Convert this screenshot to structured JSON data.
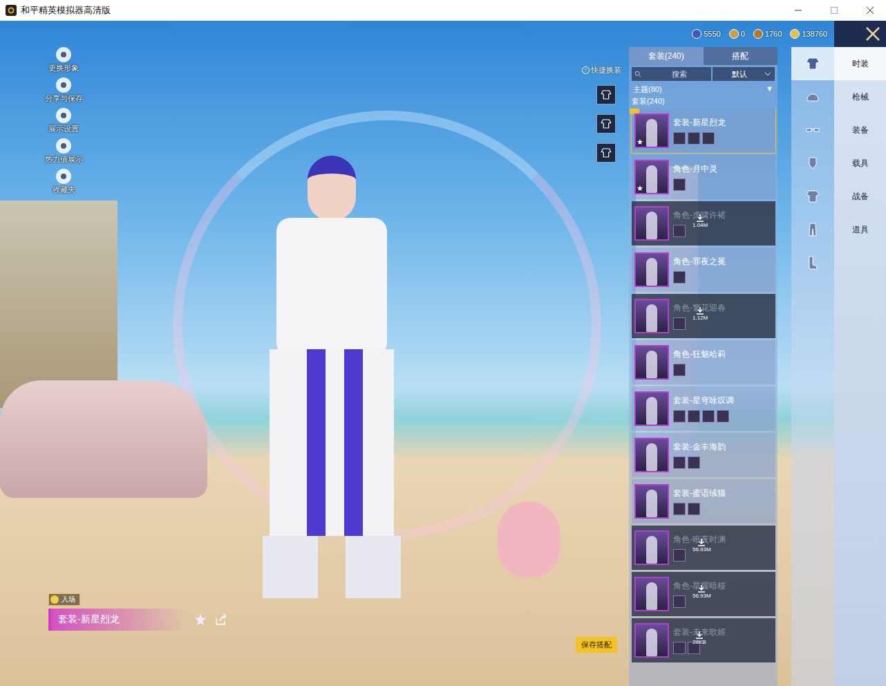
{
  "window": {
    "title": "和平精英模拟器高清版"
  },
  "currencies": [
    {
      "value": "5550",
      "color": "#3b5bb5"
    },
    {
      "value": "0",
      "color": "#c9a04a"
    },
    {
      "value": "1760",
      "color": "#b07a2a"
    },
    {
      "value": "138760",
      "color": "#e2c04a"
    }
  ],
  "leftMenu": [
    {
      "label": "更换形象"
    },
    {
      "label": "分享与保存"
    },
    {
      "label": "展示设置"
    },
    {
      "label": "热力值展示"
    },
    {
      "label": "收藏夹"
    }
  ],
  "quickChange": {
    "title": "快捷换装",
    "help": "?",
    "slots": [
      {
        "selected": false
      },
      {
        "selected": false
      },
      {
        "selected": false
      }
    ]
  },
  "tabs": [
    {
      "label": "套装(240)",
      "selected": true
    },
    {
      "label": "搭配",
      "selected": false
    }
  ],
  "search": {
    "placeholder": "搜索"
  },
  "sort": {
    "value": "默认"
  },
  "filter": {
    "label": "主题(80)",
    "arrow": "▼"
  },
  "section": "套装(240)",
  "items": [
    {
      "name": "套装-新星烈龙",
      "selected": true,
      "starred": true,
      "downloaded": true,
      "size": "",
      "parts": 3
    },
    {
      "name": "角色-月中灵",
      "selected": false,
      "starred": true,
      "downloaded": true,
      "size": "",
      "parts": 1
    },
    {
      "name": "角色-虎啸许褚",
      "selected": false,
      "starred": false,
      "downloaded": false,
      "size": "1.04M",
      "parts": 1
    },
    {
      "name": "角色-罪夜之冕",
      "selected": false,
      "starred": false,
      "downloaded": true,
      "size": "",
      "parts": 1
    },
    {
      "name": "角色-繁花迎春",
      "selected": false,
      "starred": false,
      "downloaded": false,
      "size": "1.12M",
      "parts": 1
    },
    {
      "name": "角色-狂魅哈莉",
      "selected": false,
      "starred": false,
      "downloaded": true,
      "size": "",
      "parts": 1
    },
    {
      "name": "套装-星穹咏叹调",
      "selected": false,
      "starred": false,
      "downloaded": true,
      "size": "",
      "parts": 4
    },
    {
      "name": "套装-金丰海韵",
      "selected": false,
      "starred": false,
      "downloaded": true,
      "size": "",
      "parts": 2
    },
    {
      "name": "套装-蜜语绒猫",
      "selected": false,
      "starred": false,
      "downloaded": true,
      "size": "",
      "parts": 2
    },
    {
      "name": "角色-暗夜时渊",
      "selected": false,
      "starred": false,
      "downloaded": false,
      "size": "56.93M",
      "parts": 1
    },
    {
      "name": "角色-星耀暗核",
      "selected": false,
      "starred": false,
      "downloaded": false,
      "size": "56.93M",
      "parts": 1
    },
    {
      "name": "套装-未来歌姬",
      "selected": false,
      "starred": false,
      "downloaded": false,
      "size": "28KB",
      "parts": 2
    }
  ],
  "categoryIcons": [
    {
      "selected": true
    },
    {
      "selected": false
    },
    {
      "selected": false
    },
    {
      "selected": false
    },
    {
      "selected": false
    },
    {
      "selected": false
    },
    {
      "selected": false
    }
  ],
  "categories": [
    {
      "label": "时装",
      "selected": true
    },
    {
      "label": "枪械",
      "selected": false
    },
    {
      "label": "装备",
      "selected": false
    },
    {
      "label": "载具",
      "selected": false
    },
    {
      "label": "战备",
      "selected": false
    },
    {
      "label": "道具",
      "selected": false
    }
  ],
  "nameplate": {
    "entry": "入场",
    "name": "套装-新星烈龙"
  },
  "saveButton": "保存搭配"
}
